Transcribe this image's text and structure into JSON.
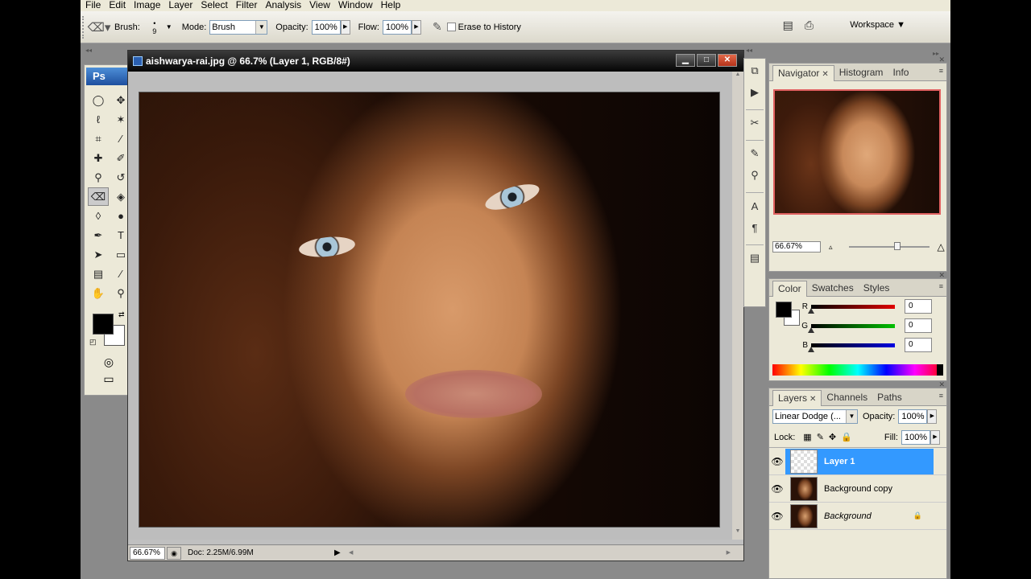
{
  "menu": [
    "File",
    "Edit",
    "Image",
    "Layer",
    "Select",
    "Filter",
    "Analysis",
    "View",
    "Window",
    "Help"
  ],
  "options": {
    "brush_label": "Brush:",
    "brush_size": "9",
    "mode_label": "Mode:",
    "mode_value": "Brush",
    "opacity_label": "Opacity:",
    "opacity_value": "100%",
    "flow_label": "Flow:",
    "flow_value": "100%",
    "erase_history_label": "Erase to History",
    "workspace_label": "Workspace ▼"
  },
  "toolbox": {
    "logo": "Ps"
  },
  "document": {
    "title": "aishwarya-rai.jpg @ 66.7% (Layer 1, RGB/8#)",
    "status_zoom": "66.67%",
    "status_doc": "Doc: 2.25M/6.99M"
  },
  "navigator": {
    "tabs": [
      "Navigator",
      "Histogram",
      "Info"
    ],
    "zoom": "66.67%"
  },
  "color_panel": {
    "tabs": [
      "Color",
      "Swatches",
      "Styles"
    ],
    "channels": [
      {
        "label": "R",
        "value": "0",
        "color": "#e00000"
      },
      {
        "label": "G",
        "value": "0",
        "color": "#00c000"
      },
      {
        "label": "B",
        "value": "0",
        "color": "#0000e0"
      }
    ]
  },
  "layers_panel": {
    "tabs": [
      "Layers",
      "Channels",
      "Paths"
    ],
    "blend_mode": "Linear Dodge (...",
    "opacity_label": "Opacity:",
    "opacity_value": "100%",
    "lock_label": "Lock:",
    "fill_label": "Fill:",
    "fill_value": "100%",
    "layers": [
      {
        "name": "Layer 1",
        "selected": true
      },
      {
        "name": "Background copy",
        "selected": false
      },
      {
        "name": "Background",
        "selected": false,
        "locked": true
      }
    ]
  },
  "colors": {
    "accent": "#3399ff",
    "title_bar": "#050505",
    "workspace_bg": "#8a8a8a"
  }
}
